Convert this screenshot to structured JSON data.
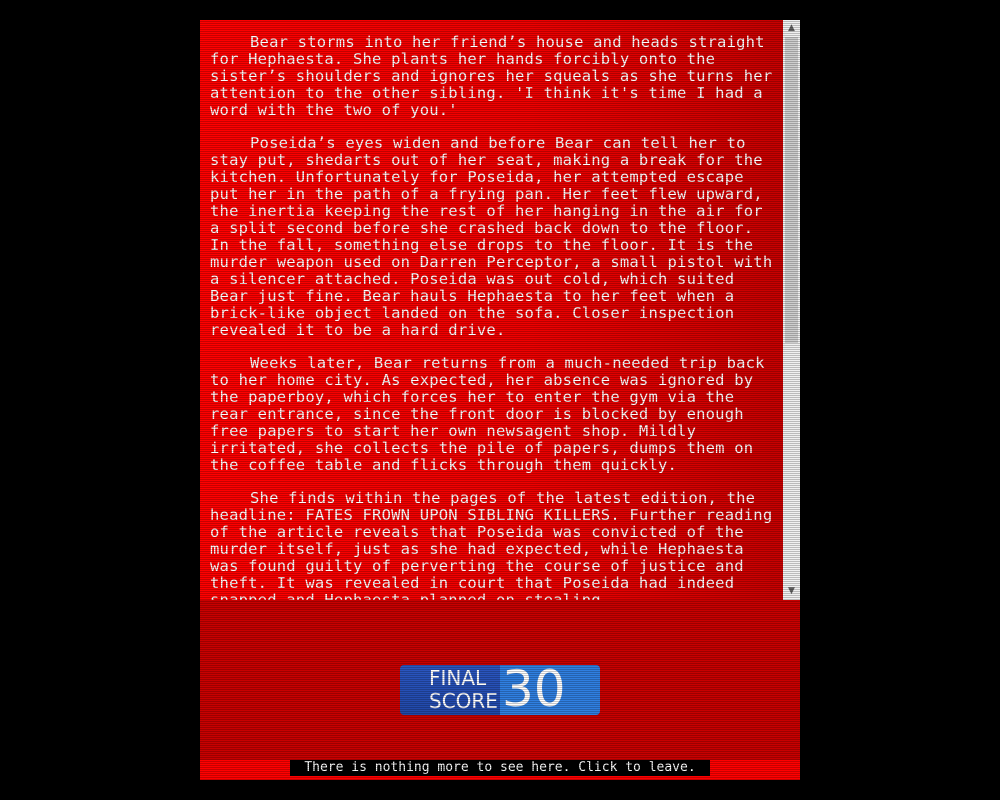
{
  "story": {
    "paragraphs": [
      "Bear storms into her friend’s house and heads straight for Hephaesta. She plants her hands forcibly onto the sister’s shoulders and ignores her squeals as she turns her attention to the other sibling. 'I think it's time I had a word with the two of you.'",
      "Poseida’s eyes widen and before Bear can tell her to stay put, shedarts out of her seat, making a break for the kitchen. Unfortunately for Poseida, her attempted escape put her in the path of a frying pan. Her feet flew upward, the inertia keeping the rest of her hanging in the air for a split second before she crashed back down to the floor. In the fall, something else drops to the floor. It is the murder weapon used on Darren Perceptor, a small pistol with a silencer attached. Poseida was out cold, which suited Bear just fine. Bear hauls Hephaesta to her feet when a brick-like object landed on the sofa. Closer inspection revealed it to be a hard drive.",
      "Weeks later, Bear returns from a much-needed trip back to her home city. As expected, her absence was ignored by the paperboy, which forces her to enter the gym via the rear entrance, since the front door is blocked by enough free papers to start her own newsagent shop. Mildly irritated, she collects the pile of papers, dumps them on the coffee table and flicks through them quickly.",
      "She finds within the pages of the latest edition, the headline: FATES FROWN UPON SIBLING KILLERS. Further reading of the article reveals that Poseida was convicted of the murder itself, just as she had expected, while Hephaesta was found guilty of perverting the course of justice and theft. It was revealed in court that Poseida had indeed snapped and Hephaesta planned on stealing"
    ]
  },
  "scrollbar": {
    "up_icon": "▲",
    "down_icon": "▼",
    "position_fraction": 0.0
  },
  "score": {
    "label_line1": "FINAL",
    "label_line2": "SCORE",
    "value": "30"
  },
  "footer": {
    "leave_text": "There is nothing more to see here. Click to leave."
  },
  "colors": {
    "background": "#000000",
    "frame_red": "#ff0000",
    "lower_red": "#c80000",
    "score_blue": "#2047a8",
    "score_value_blue": "#2f7fe0",
    "text": "#ffffff"
  }
}
